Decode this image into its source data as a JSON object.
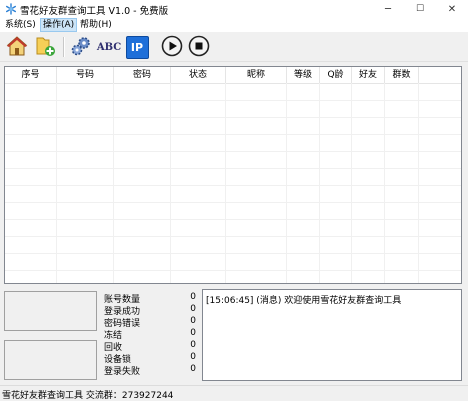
{
  "window": {
    "title": "雪花好友群查询工具 V1.0 - 免费版",
    "minimize_glyph": "─",
    "maximize_glyph": "☐",
    "close_glyph": "✕"
  },
  "menu": {
    "items": [
      {
        "label": "系统(S)"
      },
      {
        "label": "操作(A)"
      },
      {
        "label": "帮助(H)"
      }
    ],
    "active_index": 1
  },
  "toolbar": {
    "buttons": [
      {
        "icon": "home-icon"
      },
      {
        "icon": "add-folder-icon"
      },
      {
        "icon": "settings-gears-icon"
      },
      {
        "icon": "abc-text-icon",
        "text": "ABC"
      },
      {
        "icon": "ip-icon",
        "text": "IP"
      },
      {
        "icon": "play-icon"
      },
      {
        "icon": "stop-icon"
      }
    ]
  },
  "grid": {
    "columns": [
      "序号",
      "号码",
      "密码",
      "状态",
      "昵称",
      "等级",
      "Q龄",
      "好友",
      "群数"
    ],
    "rows": []
  },
  "stats": [
    {
      "label": "账号数量",
      "value": "0"
    },
    {
      "label": "登录成功",
      "value": "0"
    },
    {
      "label": "密码错误",
      "value": "0"
    },
    {
      "label": "冻结",
      "value": "0"
    },
    {
      "label": "回收",
      "value": "0"
    },
    {
      "label": "设备锁",
      "value": "0"
    },
    {
      "label": "登录失败",
      "value": "0"
    }
  ],
  "log": {
    "lines": [
      "[15:06:45] (消息) 欢迎使用雪花好友群查询工具"
    ]
  },
  "status": {
    "text": "雪花好友群查询工具 交流群：273927244"
  },
  "colors": {
    "ip_button": "#1e6fd9",
    "window_bg": "#f0f0f0",
    "menu_active": "#cce4f7"
  }
}
